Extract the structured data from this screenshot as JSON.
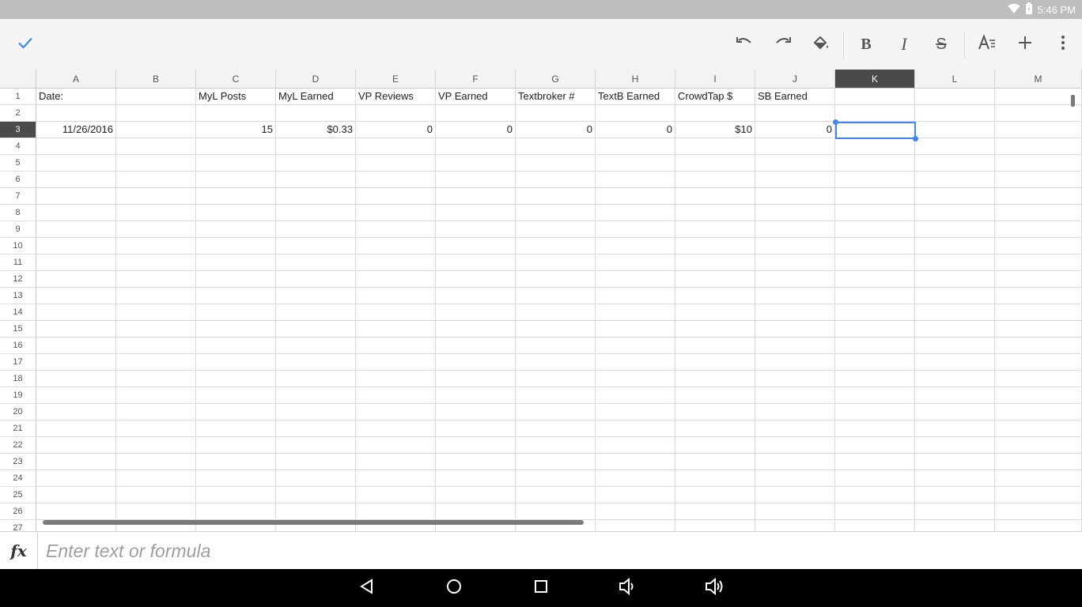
{
  "status_bar": {
    "time": "5:46 PM"
  },
  "toolbar": {
    "done_icon": "check-icon",
    "icons": [
      "undo-icon",
      "redo-icon",
      "fill-color-icon",
      "bold-icon",
      "italic-icon",
      "strikethrough-icon",
      "text-format-icon",
      "insert-icon",
      "more-options-icon"
    ],
    "accent": "#4285f4"
  },
  "sheet": {
    "columns": [
      "A",
      "B",
      "C",
      "D",
      "E",
      "F",
      "G",
      "H",
      "I",
      "J",
      "K",
      "L",
      "M"
    ],
    "selected_column": "K",
    "selected_row": "3",
    "rows": [
      "1",
      "2",
      "3",
      "4",
      "5",
      "6",
      "7",
      "8",
      "9",
      "10",
      "11",
      "12",
      "13",
      "14",
      "15",
      "16",
      "17",
      "18",
      "19",
      "20",
      "21",
      "22",
      "23",
      "24",
      "25",
      "26",
      "27"
    ],
    "row1": {
      "A": "Date:",
      "C": "MyL Posts",
      "D": "MyL Earned",
      "E": "VP Reviews",
      "F": "VP Earned",
      "G": "Textbroker #",
      "H": "TextB Earned",
      "I": "CrowdTap $",
      "J": "SB Earned"
    },
    "row3": {
      "A": "11/26/2016",
      "C": "15",
      "D": "$0.33",
      "E": "0",
      "F": "0",
      "G": "0",
      "H": "0",
      "I": "$10",
      "J": "0"
    }
  },
  "formula_bar": {
    "fx_label": "fx",
    "placeholder": "Enter text or formula",
    "value": ""
  },
  "nav_bar": {
    "icons": [
      "back-icon",
      "home-icon",
      "recents-icon",
      "volume-down-icon",
      "volume-up-icon"
    ]
  }
}
